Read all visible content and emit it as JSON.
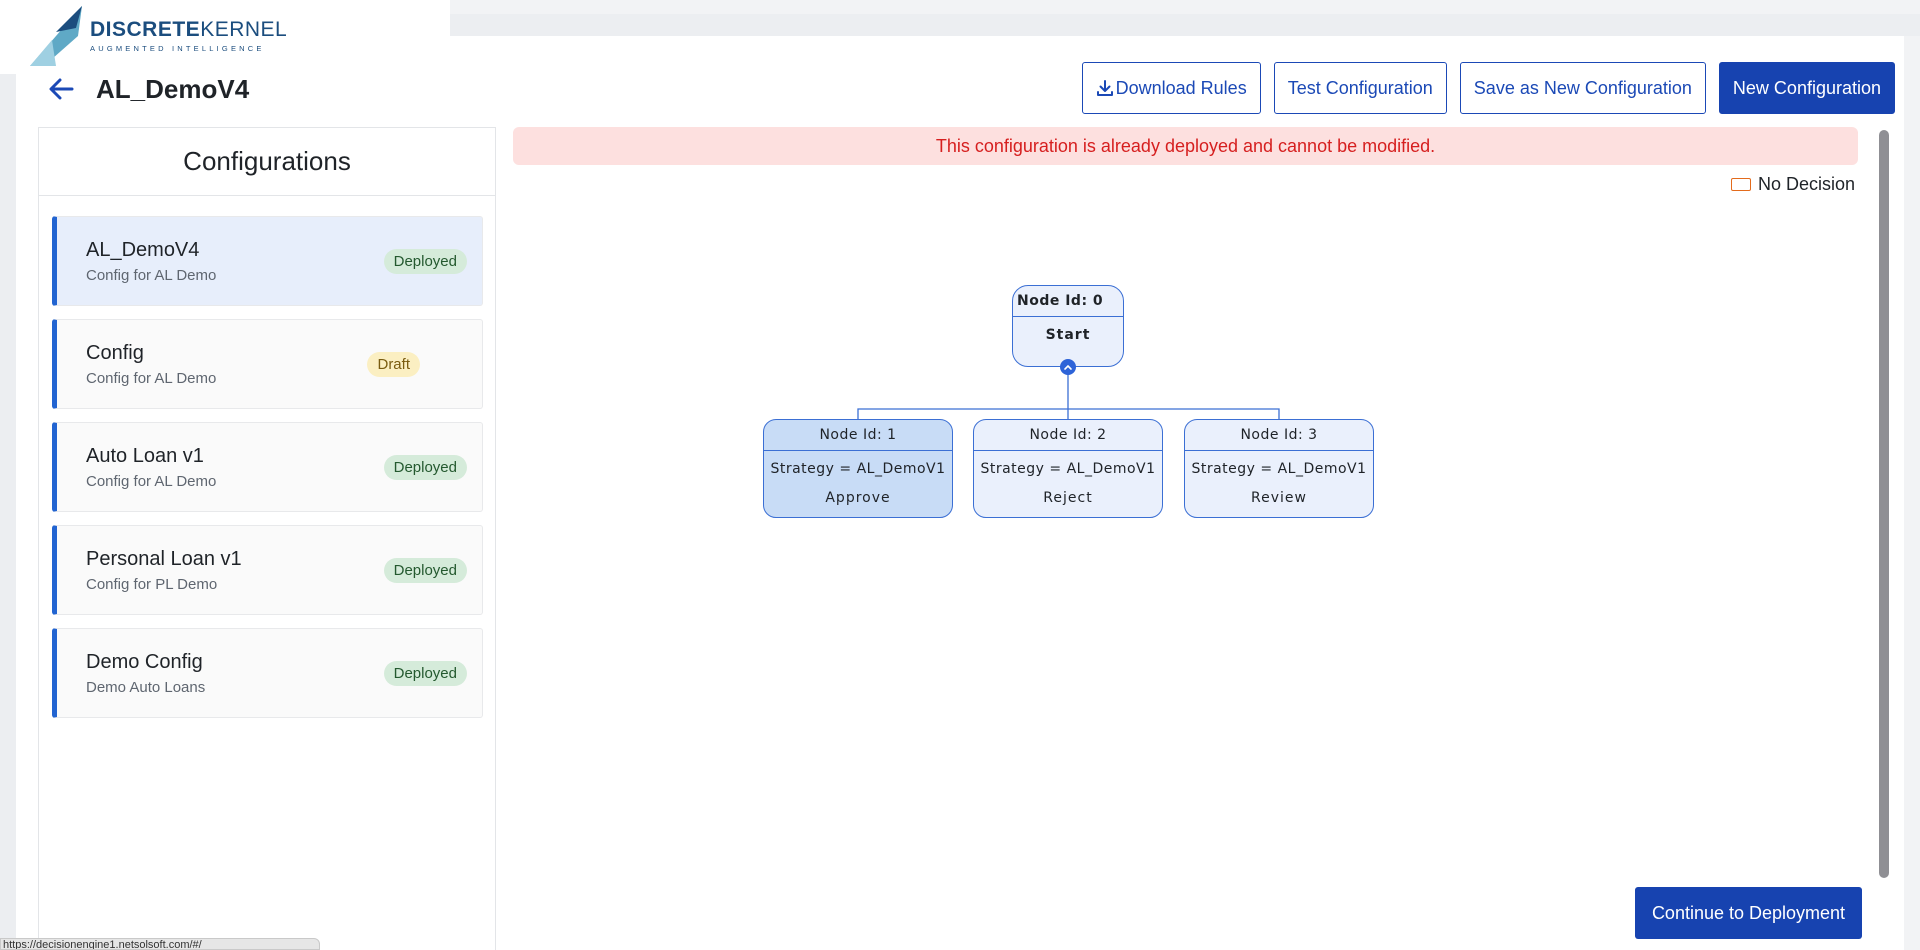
{
  "logo": {
    "brand_bold": "DISCRETE",
    "brand_light": "KERNEL",
    "tagline": "AUGMENTED INTELLIGENCE"
  },
  "header": {
    "title": "AL_DemoV4",
    "back_icon": "arrow-left-icon"
  },
  "actions": {
    "download_label": "Download Rules",
    "download_icon": "download-icon",
    "test_label": "Test Configuration",
    "save_new_label": "Save as New Configuration",
    "new_label": "New Configuration"
  },
  "sidebar": {
    "title": "Configurations",
    "items": [
      {
        "name": "AL_DemoV4",
        "description": "Config for AL Demo",
        "status": "Deployed",
        "active": true
      },
      {
        "name": "Config",
        "description": "Config for AL Demo",
        "status": "Draft",
        "active": false
      },
      {
        "name": "Auto Loan v1",
        "description": "Config for AL Demo",
        "status": "Deployed",
        "active": false
      },
      {
        "name": "Personal Loan v1",
        "description": "Config for PL Demo",
        "status": "Deployed",
        "active": false
      },
      {
        "name": "Demo Config",
        "description": "Demo Auto Loans",
        "status": "Deployed",
        "active": false
      }
    ]
  },
  "alert": {
    "message": "This configuration is already deployed and cannot be modified."
  },
  "legend": {
    "label": "No Decision",
    "color": "#e36b1c"
  },
  "tree": {
    "root": {
      "id_label": "Node Id: 0",
      "label": "Start"
    },
    "children": [
      {
        "id_label": "Node Id: 1",
        "strategy": "Strategy = AL_DemoV1",
        "decision": "Approve",
        "selected": true
      },
      {
        "id_label": "Node Id: 2",
        "strategy": "Strategy = AL_DemoV1",
        "decision": "Reject",
        "selected": false
      },
      {
        "id_label": "Node Id: 3",
        "strategy": "Strategy = AL_DemoV1",
        "decision": "Review",
        "selected": false
      }
    ]
  },
  "footer": {
    "continue_label": "Continue to Deployment",
    "status_url": "https://decisionengine1.netsolsoft.com/#/"
  },
  "colors": {
    "accent": "#1743b0",
    "sidebar_active": "#e7eefb",
    "alert_bg": "#fde0df",
    "alert_text": "#d61f1f",
    "deployed_badge": "#d5ebda",
    "draft_badge": "#fbefc2"
  }
}
